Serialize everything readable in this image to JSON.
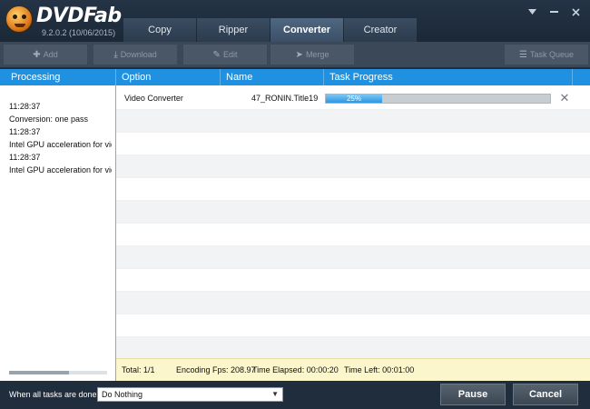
{
  "brand": {
    "name": "DVDFab",
    "version": "9.2.0.2 (10/06/2015)"
  },
  "tabs": [
    {
      "label": "Copy"
    },
    {
      "label": "Ripper"
    },
    {
      "label": "Converter",
      "active": true
    },
    {
      "label": "Creator"
    }
  ],
  "window_controls": {
    "menu_icon": "chevron-down-icon",
    "minimize_icon": "minimize-icon",
    "close_icon": "close-icon"
  },
  "toolbar": {
    "add_label": "Add",
    "download_label": "Download",
    "edit_label": "Edit",
    "merge_label": "Merge",
    "task_queue_label": "Task Queue"
  },
  "processing": {
    "header": "Processing",
    "log": [
      "11:28:37",
      "Conversion: one pass",
      "11:28:37",
      "Intel GPU acceleration for video",
      "11:28:37",
      "Intel GPU acceleration for video"
    ]
  },
  "table": {
    "columns": {
      "option": "Option",
      "name": "Name",
      "progress": "Task Progress"
    },
    "tasks": [
      {
        "option": "Video Converter",
        "name": "47_RONIN.Title19",
        "progress": 0.25,
        "progress_label": "25%"
      }
    ]
  },
  "status": {
    "total": "Total: 1/1",
    "fps": "Encoding Fps: 208.97",
    "elapsed": "Time Elapsed: 00:00:20",
    "left": "Time Left: 00:01:00"
  },
  "footer": {
    "when_done_label": "When all tasks are done:",
    "when_done_value": "Do Nothing",
    "pause_label": "Pause",
    "cancel_label": "Cancel"
  },
  "colors": {
    "accent": "#1f91e0",
    "status_bg": "#fcf6cc",
    "chrome": "#1f2d3d"
  }
}
